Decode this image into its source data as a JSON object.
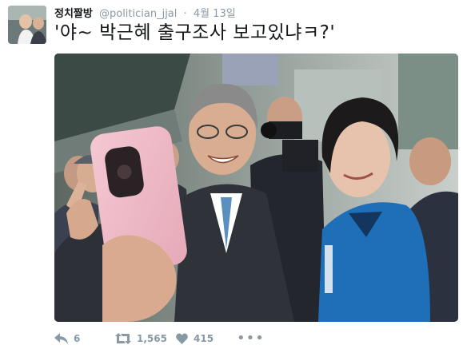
{
  "author": {
    "name": "정치짤방",
    "handle": "@politician_jjal",
    "separator": "·",
    "time": "4월 13일"
  },
  "tweet": {
    "text": "'야~ 박근혜 출구조사 보고있냐ㅋ?'"
  },
  "actions": {
    "reply_count": "6",
    "retweet_count": "1,565",
    "like_count": "415",
    "more_label": "•••"
  },
  "colors": {
    "meta_gray": "#8899a6",
    "text": "#14171a",
    "jacket_blue": "#1f6fb8"
  },
  "icons": {
    "reply": "reply-icon",
    "retweet": "retweet-icon",
    "like": "heart-icon",
    "more": "more-icon"
  }
}
